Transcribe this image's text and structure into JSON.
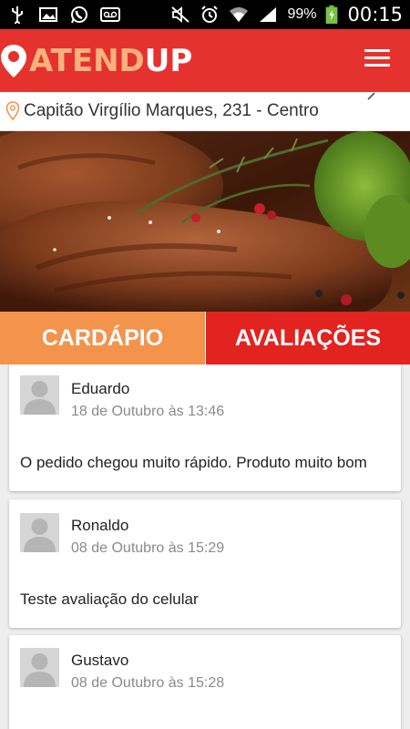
{
  "status_bar": {
    "battery": "99%",
    "time": "00:15",
    "icons_left": [
      "usb-icon",
      "image-icon",
      "whatsapp-icon",
      "voicemail-icon"
    ],
    "icons_right": [
      "mute-icon",
      "alarm-icon",
      "wifi-icon",
      "signal-icon",
      "battery-charging-icon"
    ]
  },
  "app_bar": {
    "logo_part1": "ATEND",
    "logo_part2": "UP",
    "colors": {
      "background": "#e6322e",
      "logo_accent": "#f7b27d"
    }
  },
  "address": {
    "text": "Capitão Virgílio Marques, 231 - Centro"
  },
  "tabs": [
    {
      "label": "CARDÁPIO",
      "color": "#f3934c"
    },
    {
      "label": "AVALIAÇÕES",
      "color": "#e2231f"
    }
  ],
  "reviews": [
    {
      "name": "Eduardo",
      "date": "18 de Outubro às 13:46",
      "text": "O pedido chegou muito rápido. Produto muito bom"
    },
    {
      "name": "Ronaldo",
      "date": "08 de Outubro às 15:29",
      "text": "Teste avaliação do celular"
    },
    {
      "name": "Gustavo",
      "date": "08 de Outubro às 15:28",
      "text": ""
    }
  ]
}
